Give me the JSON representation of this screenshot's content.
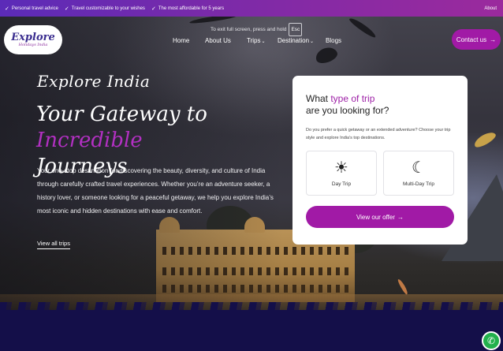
{
  "topbar": {
    "perks": [
      "Personal travel advice",
      "Travel customizable to your wishes",
      "The most affordable for 5 years"
    ],
    "about": "About"
  },
  "logo": {
    "line1": "Explore",
    "line2": "Holidays India"
  },
  "fullscreen_hint": {
    "text": "To exit full screen, press and hold",
    "key": "Esc"
  },
  "nav": {
    "home": "Home",
    "about": "About Us",
    "trips": "Trips",
    "destination": "Destination",
    "blogs": "Blogs"
  },
  "contact": {
    "label": "Contact us"
  },
  "hero": {
    "kicker": "Explore India",
    "headline_part1": "Your Gateway to ",
    "headline_highlight": "Incredible",
    "headline_part2": "Journeys",
    "description": "Your one-stop destination for discovering the beauty, diversity, and culture of India through carefully crafted travel experiences. Whether you’re an adventure seeker, a history lover, or someone looking for a peaceful getaway, we help you explore India’s most iconic and hidden destinations with ease and comfort.",
    "view_all": "View all trips"
  },
  "card": {
    "title_prefix": "What ",
    "title_highlight": "type of trip",
    "title_line2": "are you looking for?",
    "subtitle": "Do you prefer a quick getaway or an extended adventure? Choose your trip style and explore India’s top destinations.",
    "options": [
      "Day Trip",
      "Multi-Day Trip"
    ],
    "offer_button": "View our offer"
  },
  "colors": {
    "accent": "#a11aa6",
    "navy": "#140f49",
    "topbar_start": "#5b2bb8",
    "whatsapp": "#22b14c"
  },
  "icons": {
    "check": "check-icon",
    "arrow": "arrow-right-icon",
    "sun": "sun-icon",
    "moon_sun": "day-night-icon",
    "whatsapp": "whatsapp-icon"
  }
}
